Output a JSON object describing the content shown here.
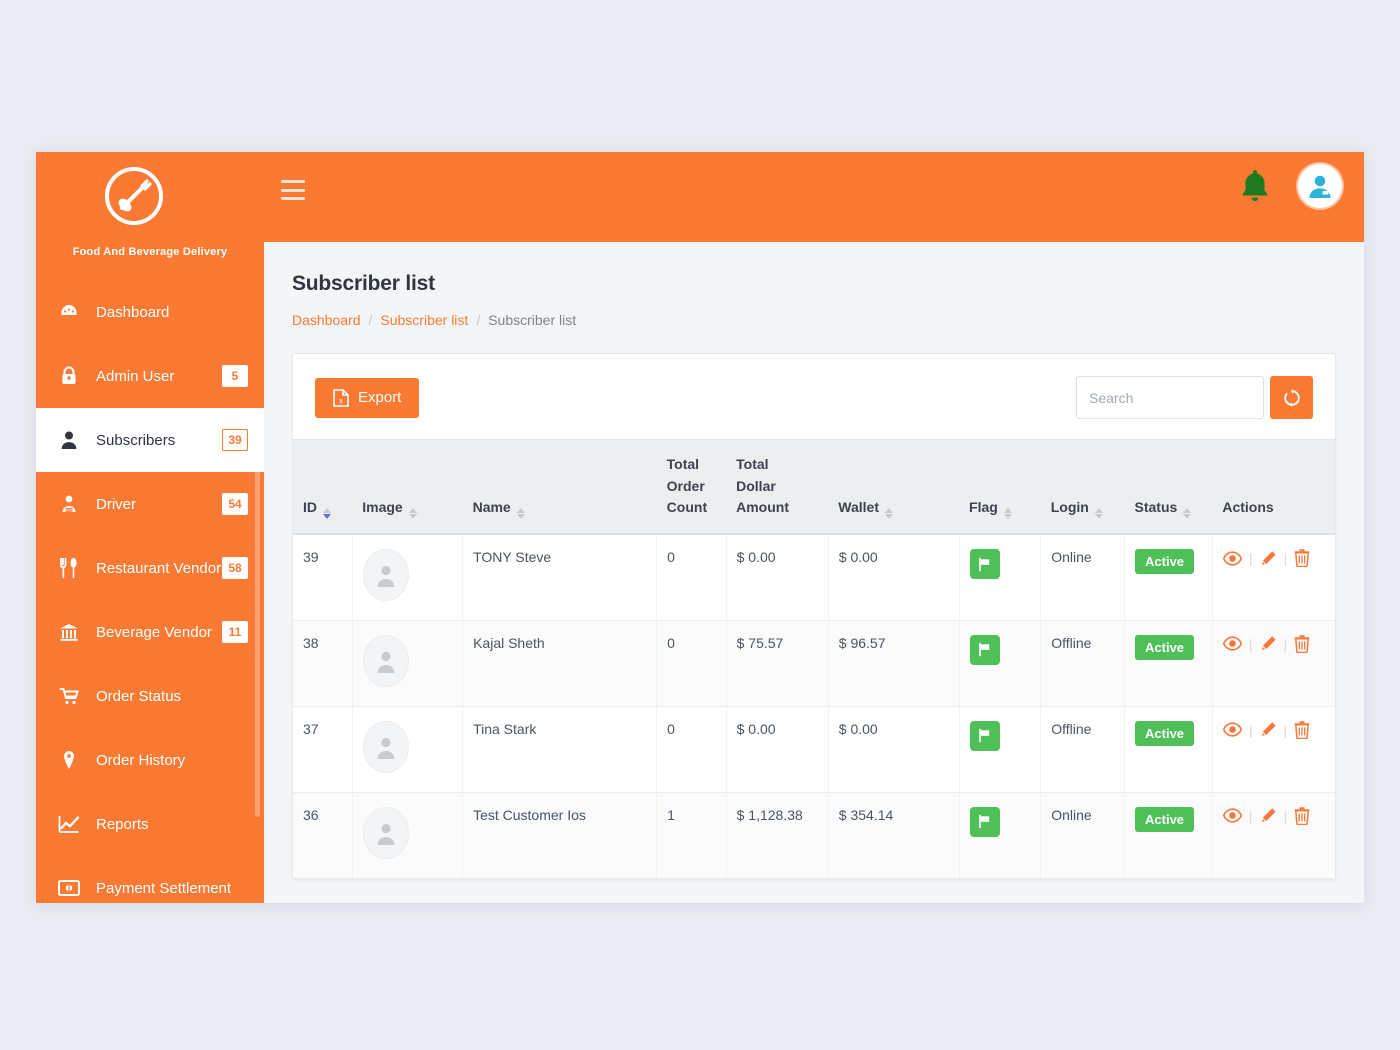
{
  "brand": {
    "name": "Food And Beverage Delivery",
    "logo_icon": "fork-spoon-circle-logo"
  },
  "topbar": {
    "menu_toggle_icon": "hamburger-icon",
    "notification_icon": "bell-icon",
    "profile_icon": "user-avatar-icon"
  },
  "sidebar": {
    "items": [
      {
        "label": "Dashboard",
        "icon": "dashboard-icon",
        "badge": "",
        "active": false
      },
      {
        "label": "Admin User",
        "icon": "lock-user-icon",
        "badge": "5",
        "active": false
      },
      {
        "label": "Subscribers",
        "icon": "user-icon",
        "badge": "39",
        "active": true
      },
      {
        "label": "Driver",
        "icon": "driver-icon",
        "badge": "54",
        "active": false
      },
      {
        "label": "Restaurant Vendor",
        "icon": "cutlery-icon",
        "badge": "58",
        "active": false
      },
      {
        "label": "Beverage Vendor",
        "icon": "bank-icon",
        "badge": "11",
        "active": false
      },
      {
        "label": "Order Status",
        "icon": "cart-icon",
        "badge": "",
        "active": false
      },
      {
        "label": "Order History",
        "icon": "map-pin-icon",
        "badge": "",
        "active": false
      },
      {
        "label": "Reports",
        "icon": "chart-line-icon",
        "badge": "",
        "active": false
      },
      {
        "label": "Payment Settlement",
        "icon": "money-icon",
        "badge": "",
        "active": false
      }
    ]
  },
  "page": {
    "title": "Subscriber list",
    "breadcrumb": [
      {
        "label": "Dashboard",
        "current": false
      },
      {
        "label": "Subscriber list",
        "current": false
      },
      {
        "label": "Subscriber list",
        "current": true
      }
    ],
    "breadcrumb_separator": "/"
  },
  "toolbar": {
    "export_label": "Export",
    "export_icon": "file-export-icon",
    "search_placeholder": "Search",
    "search_value": "",
    "refresh_icon": "refresh-icon"
  },
  "table": {
    "columns": [
      {
        "label": "ID",
        "sortable": true,
        "sorted": "desc"
      },
      {
        "label": "Image",
        "sortable": true,
        "sorted": ""
      },
      {
        "label": "Name",
        "sortable": true,
        "sorted": ""
      },
      {
        "label": "Total\nOrder\nCount",
        "sortable": false,
        "sorted": ""
      },
      {
        "label": "Total\nDollar\nAmount",
        "sortable": false,
        "sorted": ""
      },
      {
        "label": "Wallet",
        "sortable": true,
        "sorted": ""
      },
      {
        "label": "Flag",
        "sortable": true,
        "sorted": ""
      },
      {
        "label": "Login",
        "sortable": true,
        "sorted": ""
      },
      {
        "label": "Status",
        "sortable": true,
        "sorted": ""
      },
      {
        "label": "Actions",
        "sortable": false,
        "sorted": ""
      }
    ],
    "rows": [
      {
        "id": "39",
        "image": "avatar-placeholder",
        "name": "TONY Steve",
        "total_order_count": "0",
        "total_dollar_amount": "$ 0.00",
        "wallet": "$ 0.00",
        "flag": "flag-icon",
        "login": "Online",
        "login_state": "online",
        "status": "Active",
        "actions": [
          "view-icon",
          "edit-icon",
          "delete-icon"
        ]
      },
      {
        "id": "38",
        "image": "avatar-placeholder",
        "name": "Kajal Sheth",
        "total_order_count": "0",
        "total_dollar_amount": "$ 75.57",
        "wallet": "$ 96.57",
        "flag": "flag-icon",
        "login": "Offline",
        "login_state": "offline",
        "status": "Active",
        "actions": [
          "view-icon",
          "edit-icon",
          "delete-icon"
        ]
      },
      {
        "id": "37",
        "image": "avatar-placeholder",
        "name": "Tina Stark",
        "total_order_count": "0",
        "total_dollar_amount": "$ 0.00",
        "wallet": "$ 0.00",
        "flag": "flag-icon",
        "login": "Offline",
        "login_state": "offline",
        "status": "Active",
        "actions": [
          "view-icon",
          "edit-icon",
          "delete-icon"
        ]
      },
      {
        "id": "36",
        "image": "avatar-placeholder",
        "name": "Test Customer Ios",
        "total_order_count": "1",
        "total_dollar_amount": "$ 1,128.38",
        "wallet": "$ 354.14",
        "flag": "flag-icon",
        "login": "Online",
        "login_state": "online",
        "status": "Active",
        "actions": [
          "view-icon",
          "edit-icon",
          "delete-icon"
        ]
      }
    ]
  },
  "colors": {
    "brand_orange": "#fb7a33",
    "success_green": "#4fbf57",
    "online_green": "#86c56a",
    "offline_red": "#ef7a7a",
    "wallet_orange": "#f7783a",
    "page_background": "#eaebf4",
    "bell_green": "#1f7a1f",
    "avatar_cyan": "#29b6d8"
  }
}
